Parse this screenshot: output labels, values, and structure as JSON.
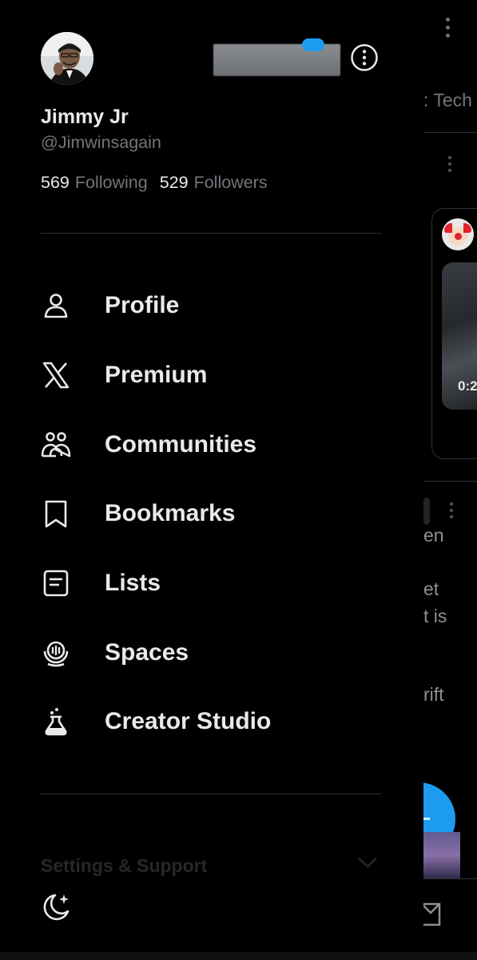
{
  "background_feed": {
    "tab_partial": ": Tech",
    "video_time_partial": "0:2",
    "snippets": [
      "en",
      "et",
      "t is",
      "rift"
    ]
  },
  "drawer": {
    "user": {
      "name": "Jimmy Jr",
      "handle": "@Jimwinsagain",
      "following_count": "569",
      "following_label": "Following",
      "followers_count": "529",
      "followers_label": "Followers"
    },
    "menu_items": [
      {
        "label": "Profile",
        "icon": "person-icon"
      },
      {
        "label": "Premium",
        "icon": "x-logo-icon"
      },
      {
        "label": "Communities",
        "icon": "communities-icon"
      },
      {
        "label": "Bookmarks",
        "icon": "bookmark-icon"
      },
      {
        "label": "Lists",
        "icon": "list-icon"
      },
      {
        "label": "Spaces",
        "icon": "spaces-icon"
      },
      {
        "label": "Creator Studio",
        "icon": "flask-icon"
      }
    ],
    "settings_label": "Settings & Support"
  },
  "colors": {
    "background": "#000000",
    "text_primary": "#e7e9ea",
    "text_secondary": "#71767b",
    "divider": "#2f3336",
    "accent": "#1d9bf0"
  }
}
